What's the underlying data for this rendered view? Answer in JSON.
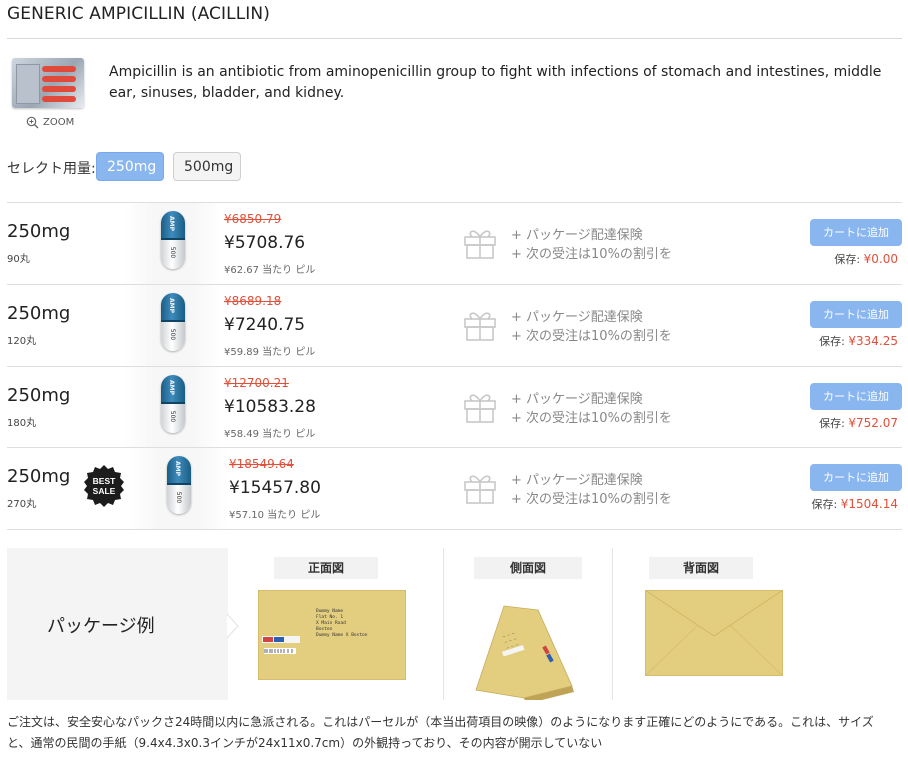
{
  "product": {
    "title": "GENERIC AMPICILLIN (ACILLIN)",
    "description": "Ampicillin is an antibiotic from aminopenicillin group to fight with infections of stomach and intestines, middle ear, sinuses, bladder, and kidney.",
    "zoom_label": "ZOOM"
  },
  "dose_selector": {
    "label": "セレクト用量:",
    "options": [
      "250mg",
      "500mg"
    ],
    "selected": "250mg"
  },
  "capsule_imprint": {
    "top": "AMP",
    "bottom": "500"
  },
  "offers": [
    {
      "dose": "250mg",
      "quantity": "90丸",
      "old_price": "¥6850.79",
      "price": "¥5708.76",
      "per_pill": "¥62.67 当たり ピル",
      "perk1": "+ パッケージ配達保険",
      "perk2": "+ 次の受注は10%の割引を",
      "cart_label": "カートに追加",
      "save_label": "保存:",
      "save_amount": "¥0.00"
    },
    {
      "dose": "250mg",
      "quantity": "120丸",
      "old_price": "¥8689.18",
      "price": "¥7240.75",
      "per_pill": "¥59.89 当たり ピル",
      "perk1": "+ パッケージ配達保険",
      "perk2": "+ 次の受注は10%の割引を",
      "cart_label": "カートに追加",
      "save_label": "保存:",
      "save_amount": "¥334.25"
    },
    {
      "dose": "250mg",
      "quantity": "180丸",
      "old_price": "¥12700.21",
      "price": "¥10583.28",
      "per_pill": "¥58.49 当たり ピル",
      "perk1": "+ パッケージ配達保険",
      "perk2": "+ 次の受注は10%の割引を",
      "cart_label": "カートに追加",
      "save_label": "保存:",
      "save_amount": "¥752.07"
    },
    {
      "dose": "250mg",
      "quantity": "270丸",
      "old_price": "¥18549.64",
      "price": "¥15457.80",
      "per_pill": "¥57.10 当たり ピル",
      "perk1": "+ パッケージ配達保険",
      "perk2": "+ 次の受注は10%の割引を",
      "cart_label": "カートに追加",
      "save_label": "保存:",
      "save_amount": "¥1504.14",
      "badge_line1": "BEST",
      "badge_line2": "SALE"
    }
  ],
  "package": {
    "label": "パッケージ例",
    "views": [
      "正面図",
      "側面図",
      "背面図"
    ],
    "envelope_text": [
      "Dummy Name",
      "Flat No. 1",
      "X Main Road",
      "Boston",
      "Dummy Name X Boston"
    ]
  },
  "footnote": "ご注文は、安全安心なパックさ24時間以内に急派される。これはパーセルが（本当出荷項目の映像）のようになります正確にどのようにである。これは、サイズと、通常の民間の手紙（9.4x4.3x0.3インチが24x11x0.7cm）の外観持っており、その内容が開示していない",
  "colors": {
    "accent": "#8ab6f0",
    "sale_red": "#e0503a",
    "capsule_blue": "#1f6b96"
  }
}
